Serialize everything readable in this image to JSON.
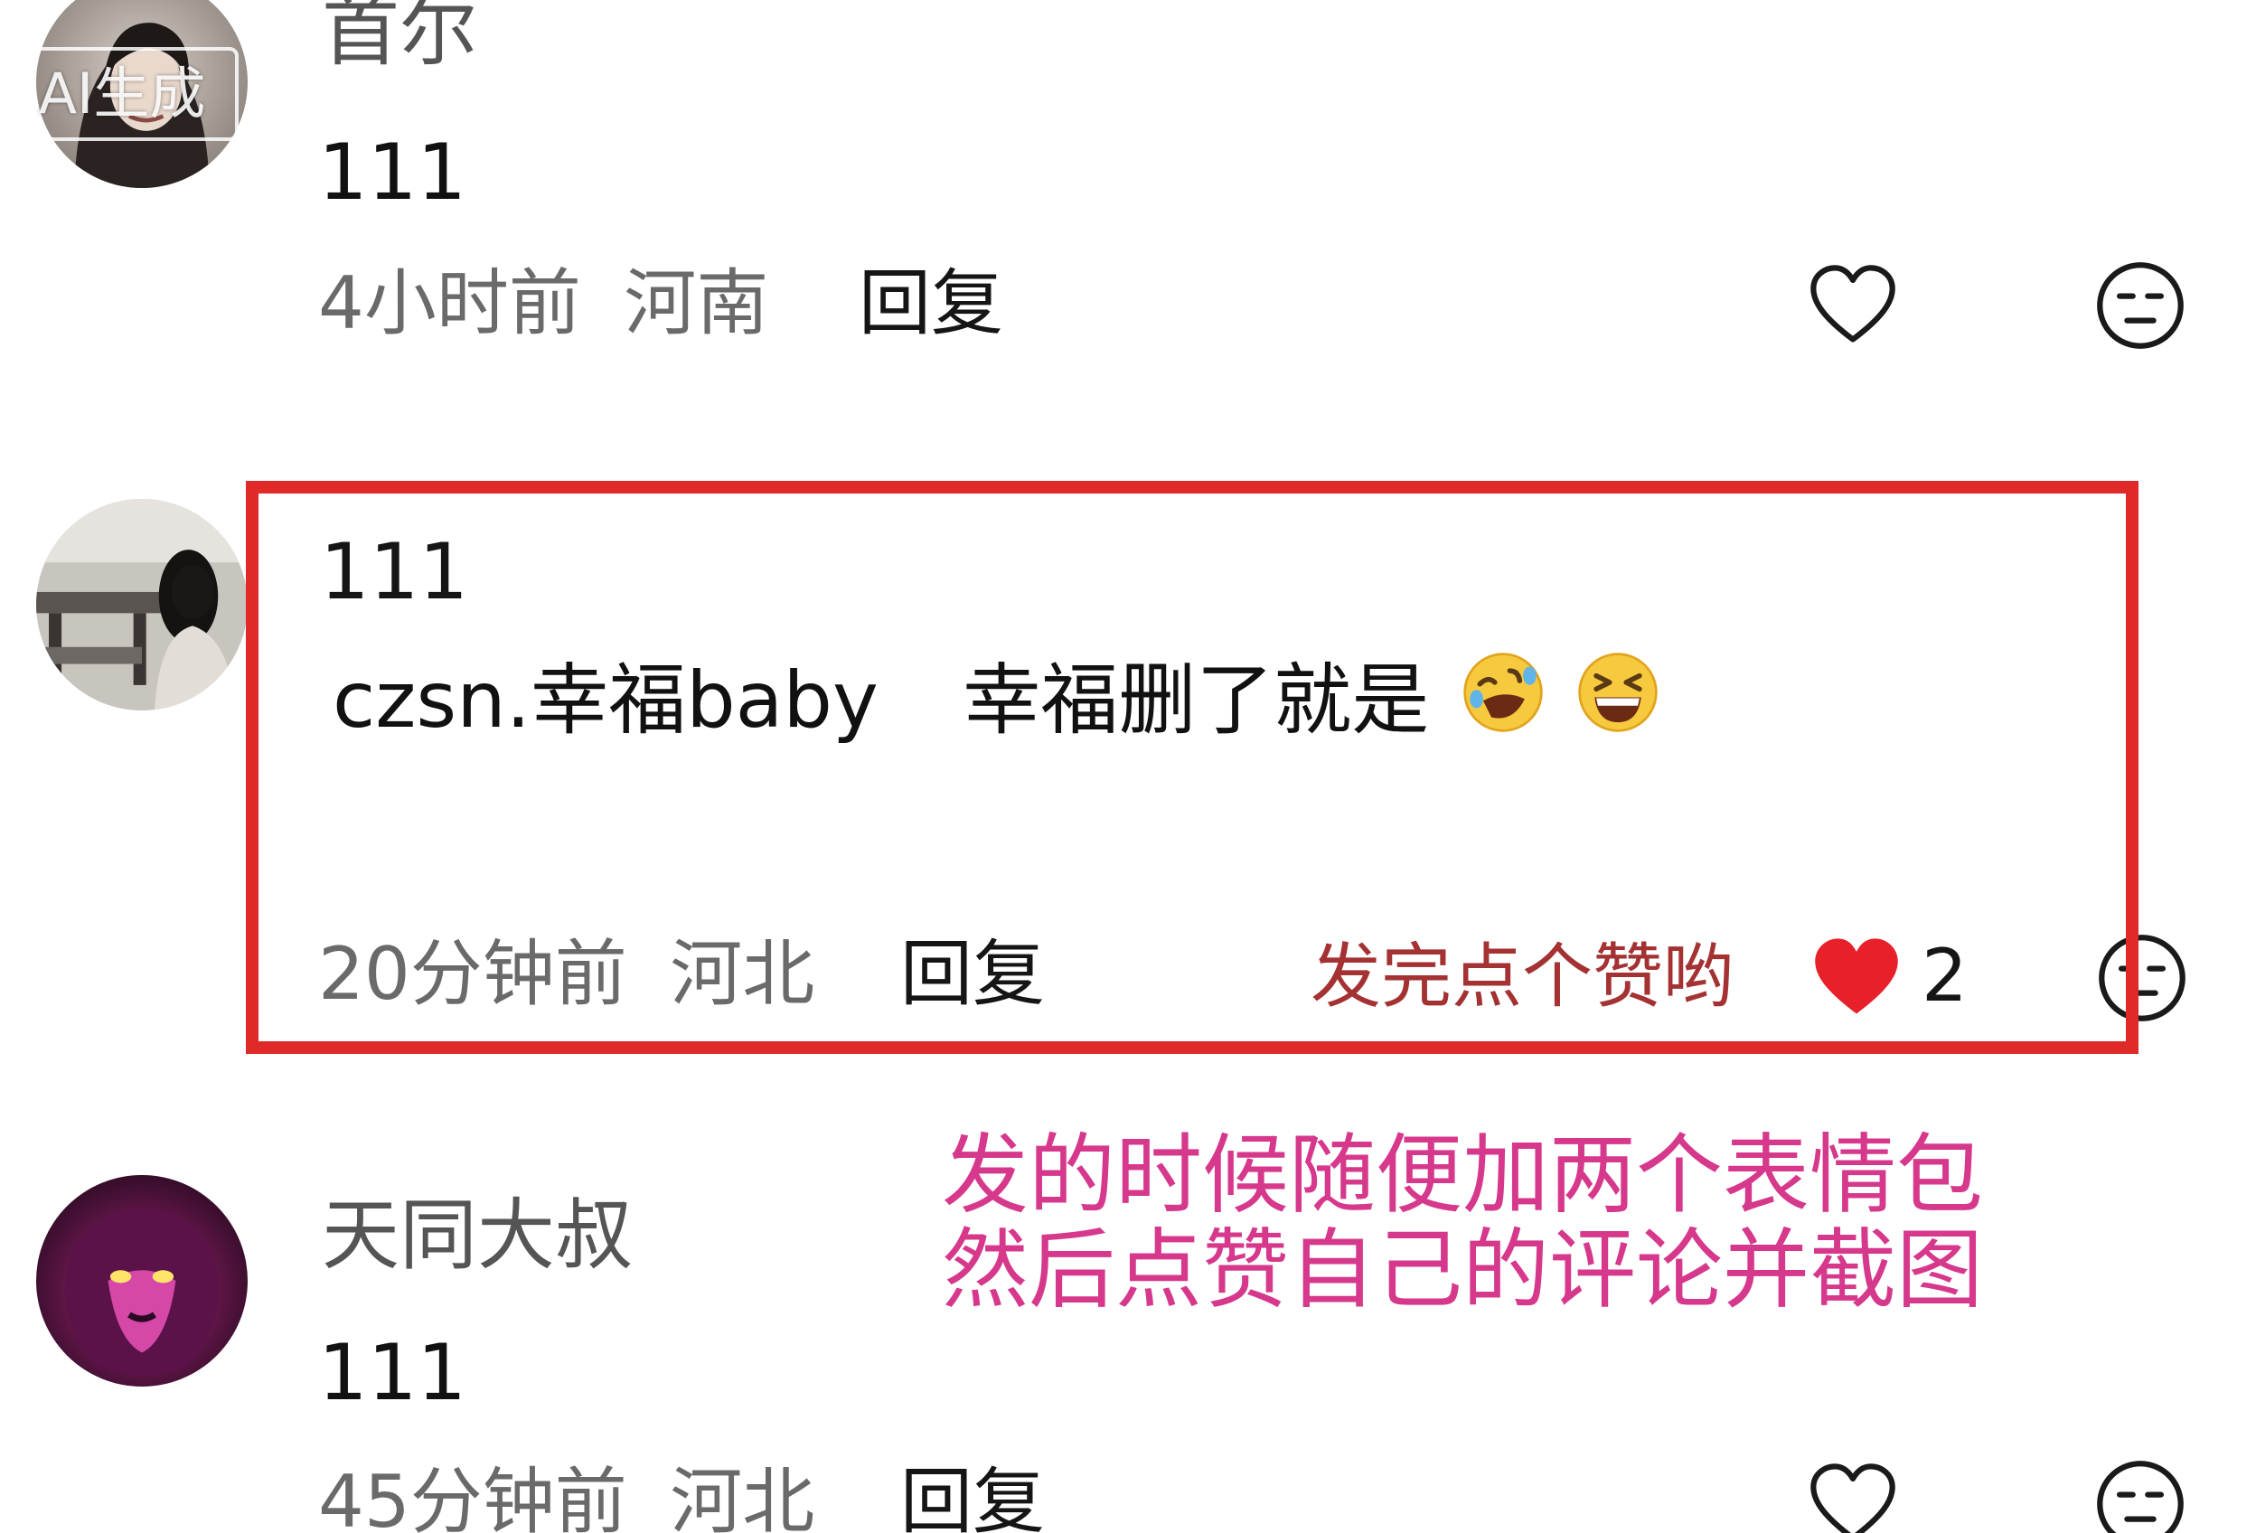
{
  "comments": [
    {
      "username": "首尔",
      "avatar_badge": "AI生成",
      "text": "111",
      "time": "4小时前",
      "location": "河南",
      "reply_label": "回复"
    },
    {
      "username": "111",
      "text_mention": "czsn.幸福baby",
      "text_body": "幸福删了就是",
      "emojis": [
        "rolling-on-floor-laughing-emoji",
        "grinning-squinting-emoji"
      ],
      "time": "20分钟前",
      "location": "河北",
      "reply_label": "回复",
      "liked": true,
      "like_count": "2"
    },
    {
      "username": "天同大叔",
      "text": "111",
      "time": "45分钟前",
      "location": "河北",
      "reply_label": "回复"
    }
  ],
  "annotations": {
    "inside_box": "发完点个赞哟",
    "note_line1": "发的时候随便加两个表情包",
    "note_line2": "然后点赞自己的评论并截图"
  },
  "colors": {
    "highlight_border": "#e02a2a",
    "annotation_red": "#a43232",
    "annotation_pink": "#d6388c",
    "liked_heart": "#e8202a"
  }
}
